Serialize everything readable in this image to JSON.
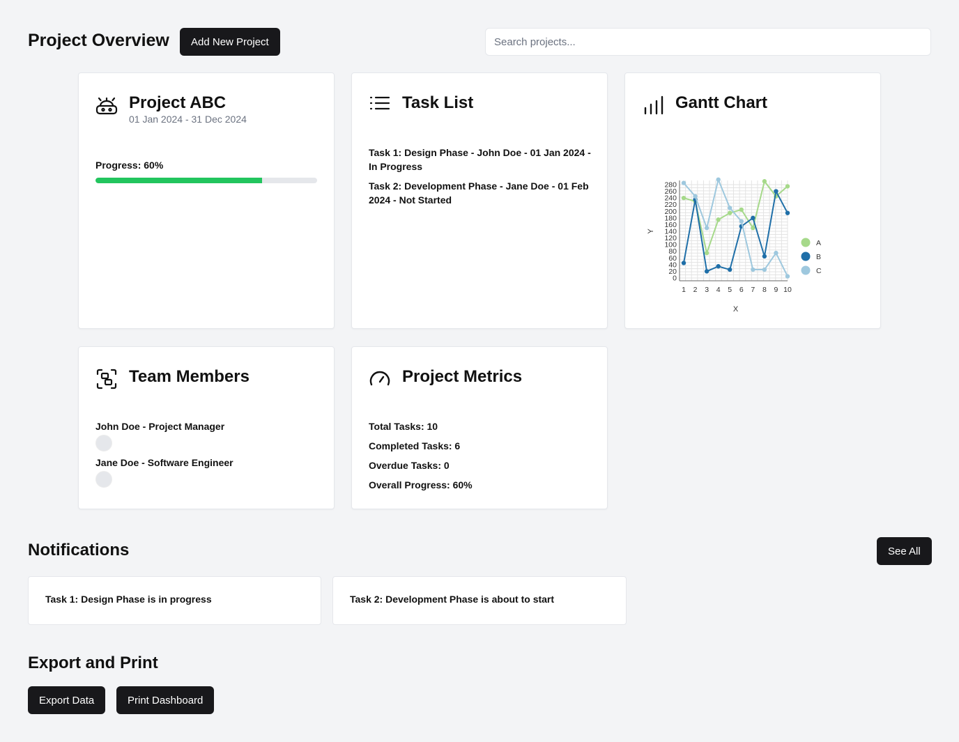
{
  "header": {
    "title": "Project Overview",
    "add_button": "Add New Project",
    "search_placeholder": "Search projects..."
  },
  "project_card": {
    "title": "Project ABC",
    "dates": "01 Jan 2024 - 31 Dec 2024",
    "progress_label": "Progress: 60%",
    "progress_fraction": 0.75,
    "progress_color": "#22c55e"
  },
  "task_card": {
    "title": "Task List",
    "tasks": [
      "Task 1: Design Phase - John Doe - 01 Jan 2024 - In Progress",
      "Task 2: Development Phase - Jane Doe - 01 Feb 2024 - Not Started"
    ]
  },
  "gantt_card": {
    "title": "Gantt Chart"
  },
  "chart_data": {
    "type": "line",
    "xlabel": "X",
    "ylabel": "Y",
    "x": [
      1,
      2,
      3,
      4,
      5,
      6,
      7,
      8,
      9,
      10
    ],
    "ylim": [
      0,
      280
    ],
    "yticks": [
      0,
      20,
      40,
      60,
      80,
      100,
      120,
      140,
      160,
      180,
      200,
      220,
      240,
      260,
      280
    ],
    "grid": true,
    "legend": "right",
    "series": [
      {
        "name": "A",
        "color": "#a6d98a",
        "values": [
          240,
          230,
          75,
          175,
          195,
          205,
          150,
          290,
          245,
          275
        ]
      },
      {
        "name": "B",
        "color": "#1f6fa8",
        "values": [
          45,
          235,
          20,
          35,
          25,
          155,
          180,
          65,
          260,
          195
        ]
      },
      {
        "name": "C",
        "color": "#9ec8de",
        "values": [
          285,
          245,
          150,
          295,
          210,
          170,
          25,
          25,
          75,
          5
        ]
      }
    ]
  },
  "team_card": {
    "title": "Team Members",
    "members": [
      {
        "label": "John Doe - Project Manager"
      },
      {
        "label": "Jane Doe - Software Engineer"
      }
    ]
  },
  "metrics_card": {
    "title": "Project Metrics",
    "items": [
      "Total Tasks: 10",
      "Completed Tasks: 6",
      "Overdue Tasks: 0",
      "Overall Progress: 60%"
    ]
  },
  "notifications": {
    "title": "Notifications",
    "see_all": "See All",
    "items": [
      "Task 1: Design Phase is in progress",
      "Task 2: Development Phase is about to start"
    ]
  },
  "export": {
    "title": "Export and Print",
    "export_button": "Export Data",
    "print_button": "Print Dashboard"
  },
  "icons": {
    "project": "robot-icon",
    "tasks": "list-icon",
    "gantt": "bar-chart-icon",
    "team": "team-scan-icon",
    "metrics": "gauge-icon"
  }
}
